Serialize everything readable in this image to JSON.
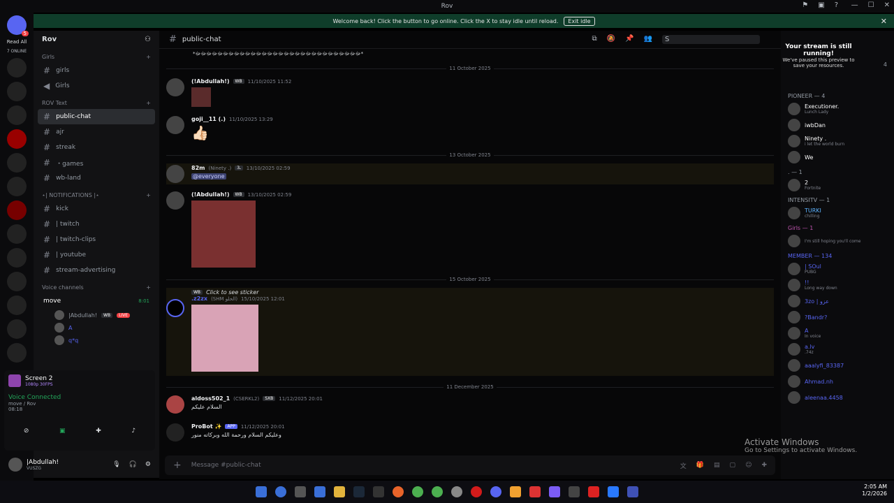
{
  "window": {
    "title": "Rov"
  },
  "banner": {
    "text": "Welcome back! Click the button to go online. Click the X to stay idle until reload.",
    "button": "Exit idle",
    "close": "✕"
  },
  "servers": {
    "read_all": "Read All",
    "online": "7 ONLINE"
  },
  "sidebar": {
    "server_name": "Rov",
    "categories": [
      {
        "name": "Girls"
      },
      {
        "name": "ROV Text"
      },
      {
        "name": "⋆| NOTIFICATIONS |⋆"
      },
      {
        "name": "Voice channels"
      }
    ],
    "girls_channels": [
      "girls",
      "Girls"
    ],
    "text_channels": [
      "public-chat",
      "ajr",
      "streak",
      "・games",
      "wb-land"
    ],
    "notif_channels": [
      "kick",
      "| twitch",
      "| twitch-clips",
      "| youtube",
      "stream-advertising"
    ],
    "voice": {
      "channel": "move",
      "duration": "8:01",
      "live": "LIVE",
      "users": [
        "|Abdullah!",
        "A",
        "q*q"
      ],
      "tag": "WB"
    }
  },
  "screen_panel": {
    "title": "Screen 2",
    "sub": "1080p 30FPS"
  },
  "voice_panel": {
    "status": "Voice Connected",
    "channel": "move / Rov",
    "time": "08:18"
  },
  "user": {
    "name": "|Abdullah!",
    "tag": "VUSZG"
  },
  "channel_header": {
    "name": "public-chat",
    "search": "S"
  },
  "messages": {
    "top_text": "*ﷻﷻﷻﷻﷻﷻﷻﷻﷻﷻﷻﷻﷻﷻﷻﷻﷻﷻﷻﷻﷻﷻﷻﷻﷻﷻﷻﷻﷻﷻ*",
    "dates": [
      "11 October 2025",
      "13 October 2025",
      "15 October 2025",
      "11 December 2025"
    ],
    "list": [
      {
        "name": "(!Abdullah!)",
        "tag": "WB",
        "time": "11/10/2025 11:52"
      },
      {
        "name": "goji__11 (.)",
        "time": "11/10/2025 13:29",
        "text": "👍🏻"
      },
      {
        "name": "82m",
        "sub": "(Ninety .)",
        "tag": "ـ3",
        "time": "13/10/2025 02:59",
        "text": "@everyone"
      },
      {
        "name": "(!Abdullah!)",
        "tag": "WB",
        "time": "13/10/2025 02:59"
      },
      {
        "name": ".z2zx",
        "sub": "(SHM الحلو)",
        "time": "15/10/2025 12:01",
        "reply": "Click to see sticker",
        "reply_tag": "WB"
      },
      {
        "name": "aldoss502_1",
        "sub": "(CSERKL2)",
        "tag": "SXB",
        "time": "11/12/2025 20:01",
        "text": "السلام عليكم"
      },
      {
        "name": "ProBot ✨",
        "tag": "APP",
        "time": "11/12/2025 20:01",
        "text": "وعليكم السلام ورحمة الله وبركاته منور"
      }
    ]
  },
  "composer": {
    "placeholder": "Message #public-chat"
  },
  "tooltip": {
    "title": "Your stream is still running!",
    "desc": "We've paused this preview to save your resources."
  },
  "members": {
    "count": "4",
    "groups": [
      {
        "title": "PIONEER — 4",
        "items": [
          {
            "name": "Executioner.",
            "sub": "Lunch Lady"
          },
          {
            "name": "iwbDan",
            "sub": ""
          },
          {
            "name": "Ninety .",
            "sub": "i let the world burn"
          },
          {
            "name": "We",
            "sub": "..."
          }
        ]
      },
      {
        "title": ". — 1",
        "items": [
          {
            "name": "2",
            "sub": "Fortnite"
          }
        ]
      },
      {
        "title": "INTENSITV — 1",
        "items": [
          {
            "name": "TURKI",
            "sub": "chilling"
          }
        ]
      },
      {
        "title": "Girls — 1",
        "items": [
          {
            "name": "",
            "sub": "I'm still hoping you'll come"
          }
        ]
      },
      {
        "title": "MEMBER — 134",
        "items": [
          {
            "name": "| SOul",
            "sub": "PUBG"
          },
          {
            "name": "!!",
            "sub": "Long way down"
          },
          {
            "name": "3zo | عزو",
            "sub": ""
          },
          {
            "name": "?Bandr?",
            "sub": ""
          },
          {
            "name": "A",
            "sub": "In voice"
          },
          {
            "name": "a.lv",
            "sub": ".74z"
          },
          {
            "name": "aaalyfi_83387",
            "sub": ""
          },
          {
            "name": "Ahmad.nh",
            "sub": ""
          },
          {
            "name": "aleenaa.4458",
            "sub": ""
          }
        ]
      }
    ]
  },
  "watermark": {
    "title": "Activate Windows",
    "sub": "Go to Settings to activate Windows."
  },
  "clock": {
    "time": "2:05 AM",
    "date": "1/2/2026"
  }
}
